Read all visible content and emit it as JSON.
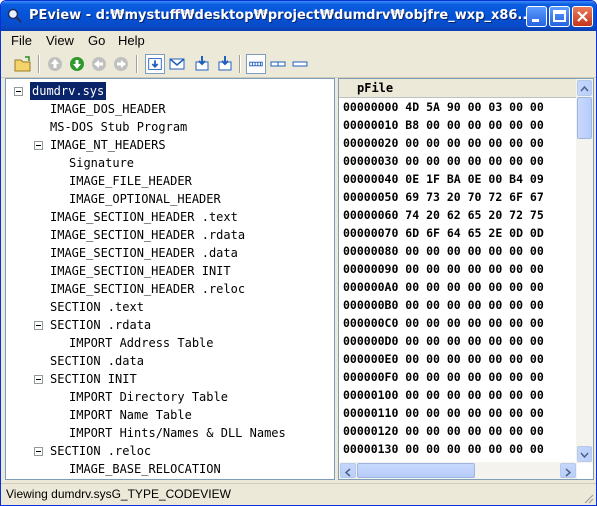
{
  "window": {
    "title": "PEview - d:₩mystuff₩desktop₩project₩dumdrv₩objfre_wxp_x86..."
  },
  "menu": [
    "File",
    "View",
    "Go",
    "Help"
  ],
  "tree": [
    {
      "label": "dumdrv.sys",
      "depth": 0,
      "expander": true,
      "selected": true
    },
    {
      "label": "IMAGE_DOS_HEADER",
      "depth": 1,
      "expander": false
    },
    {
      "label": "MS-DOS Stub Program",
      "depth": 1,
      "expander": false
    },
    {
      "label": "IMAGE_NT_HEADERS",
      "depth": 1,
      "expander": true
    },
    {
      "label": "Signature",
      "depth": 2,
      "expander": false
    },
    {
      "label": "IMAGE_FILE_HEADER",
      "depth": 2,
      "expander": false
    },
    {
      "label": "IMAGE_OPTIONAL_HEADER",
      "depth": 2,
      "expander": false
    },
    {
      "label": "IMAGE_SECTION_HEADER .text",
      "depth": 1,
      "expander": false
    },
    {
      "label": "IMAGE_SECTION_HEADER .rdata",
      "depth": 1,
      "expander": false
    },
    {
      "label": "IMAGE_SECTION_HEADER .data",
      "depth": 1,
      "expander": false
    },
    {
      "label": "IMAGE_SECTION_HEADER INIT",
      "depth": 1,
      "expander": false
    },
    {
      "label": "IMAGE_SECTION_HEADER .reloc",
      "depth": 1,
      "expander": false
    },
    {
      "label": "SECTION .text",
      "depth": 1,
      "expander": false
    },
    {
      "label": "SECTION .rdata",
      "depth": 1,
      "expander": true
    },
    {
      "label": "IMPORT Address Table",
      "depth": 2,
      "expander": false
    },
    {
      "label": "SECTION .data",
      "depth": 1,
      "expander": false
    },
    {
      "label": "SECTION INIT",
      "depth": 1,
      "expander": true
    },
    {
      "label": "IMPORT Directory Table",
      "depth": 2,
      "expander": false
    },
    {
      "label": "IMPORT Name Table",
      "depth": 2,
      "expander": false
    },
    {
      "label": "IMPORT Hints/Names & DLL Names",
      "depth": 2,
      "expander": false
    },
    {
      "label": "SECTION .reloc",
      "depth": 1,
      "expander": true
    },
    {
      "label": "IMAGE_BASE_RELOCATION",
      "depth": 2,
      "expander": false
    }
  ],
  "hex": {
    "header": "pFile",
    "rows": [
      "00000000 4D 5A 90 00 03 00 00",
      "00000010 B8 00 00 00 00 00 00",
      "00000020 00 00 00 00 00 00 00",
      "00000030 00 00 00 00 00 00 00",
      "00000040 0E 1F BA 0E 00 B4 09",
      "00000050 69 73 20 70 72 6F 67",
      "00000060 74 20 62 65 20 72 75",
      "00000070 6D 6F 64 65 2E 0D 0D",
      "00000080 00 00 00 00 00 00 00",
      "00000090 00 00 00 00 00 00 00",
      "000000A0 00 00 00 00 00 00 00",
      "000000B0 00 00 00 00 00 00 00",
      "000000C0 00 00 00 00 00 00 00",
      "000000D0 00 00 00 00 00 00 00",
      "000000E0 00 00 00 00 00 00 00",
      "000000F0 00 00 00 00 00 00 00",
      "00000100 00 00 00 00 00 00 00",
      "00000110 00 00 00 00 00 00 00",
      "00000120 00 00 00 00 00 00 00",
      "00000130 00 00 00 00 00 00 00"
    ]
  },
  "status": {
    "text": "Viewing dumdrv.sysG_TYPE_CODEVIEW"
  },
  "icons": {
    "title": "peview-app-icon",
    "toolbar": [
      "open-folder-icon",
      "up-icon",
      "forward-icon",
      "back-icon",
      "next-icon",
      "hex-view-icon",
      "envelope-icon",
      "import-icon",
      "export-icon",
      "byte-view-icon",
      "word-view-icon",
      "dword-view-icon"
    ]
  },
  "colors": {
    "selection": "#0a246a",
    "titlebar": "#0453d6"
  }
}
